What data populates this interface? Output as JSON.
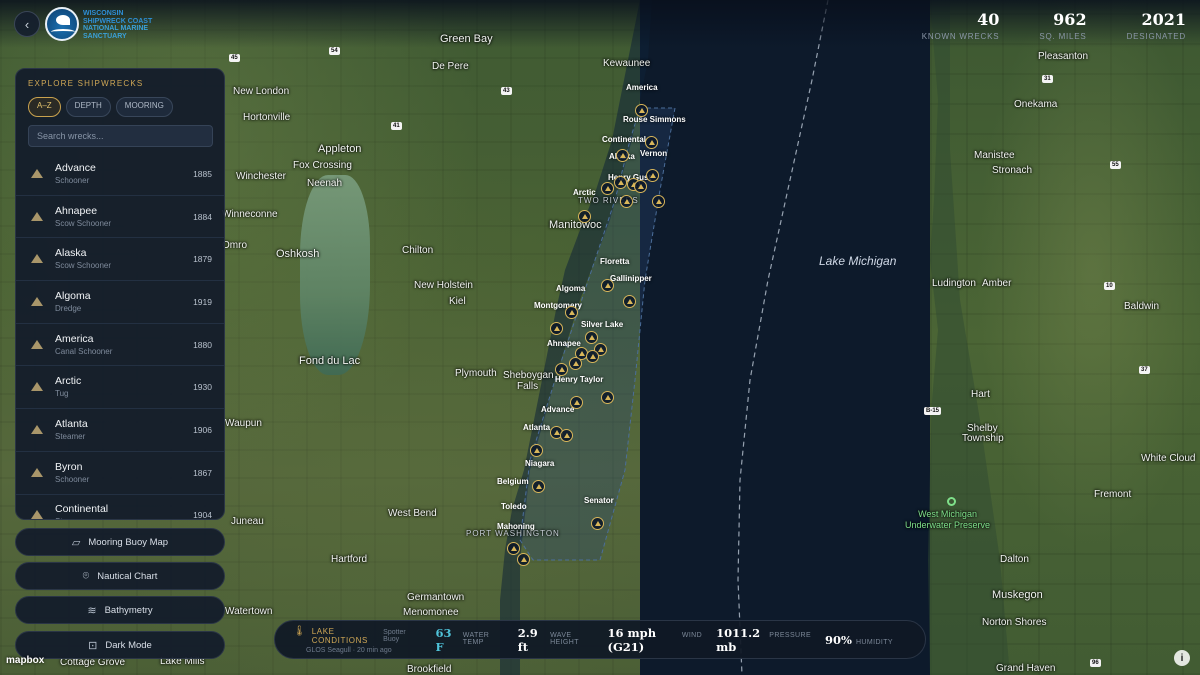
{
  "header": {
    "logo_lines": [
      "WISCONSIN",
      "SHIPWRECK COAST",
      "NATIONAL MARINE",
      "SANCTUARY"
    ],
    "stats": [
      {
        "value": "40",
        "label": "KNOWN WRECKS"
      },
      {
        "value": "962",
        "label": "SQ. MILES"
      },
      {
        "value": "2021",
        "label": "DESIGNATED"
      }
    ]
  },
  "sidebar": {
    "title": "EXPLORE SHIPWRECKS",
    "tabs": [
      "A–Z",
      "DEPTH",
      "MOORING"
    ],
    "active_tab": "A–Z",
    "search_placeholder": "Search wrecks...",
    "wrecks": [
      {
        "name": "Advance",
        "type": "Schooner",
        "year": "1885"
      },
      {
        "name": "Ahnapee",
        "type": "Scow Schooner",
        "year": "1884"
      },
      {
        "name": "Alaska",
        "type": "Scow Schooner",
        "year": "1879"
      },
      {
        "name": "Algoma",
        "type": "Dredge",
        "year": "1919"
      },
      {
        "name": "America",
        "type": "Canal Schooner",
        "year": "1880"
      },
      {
        "name": "Arctic",
        "type": "Tug",
        "year": "1930"
      },
      {
        "name": "Atlanta",
        "type": "Steamer",
        "year": "1906"
      },
      {
        "name": "Byron",
        "type": "Schooner",
        "year": "1867"
      },
      {
        "name": "Continental",
        "type": "Steamer",
        "year": "1904"
      }
    ]
  },
  "layers": [
    {
      "label": "Mooring Buoy Map",
      "icon": "map-icon"
    },
    {
      "label": "Nautical Chart",
      "icon": "pin-icon"
    },
    {
      "label": "Bathymetry",
      "icon": "waves-icon"
    },
    {
      "label": "Dark Mode",
      "icon": "target-icon"
    }
  ],
  "conditions": {
    "title": "LAKE CONDITIONS",
    "source": "Spotter Buoy",
    "subtitle": "GLOS Seagull · 20 min ago",
    "metrics": [
      {
        "value": "63 F",
        "unit": "WATER TEMP"
      },
      {
        "value": "2.9 ft",
        "unit": "WAVE HEIGHT"
      },
      {
        "value": "16 mph (G21)",
        "unit": "WIND"
      },
      {
        "value": "1011.2 mb",
        "unit": "PRESSURE"
      },
      {
        "value": "90%",
        "unit": "HUMIDITY"
      }
    ]
  },
  "map": {
    "water_label": "Lake Michigan",
    "preserve_label_1": "West Michigan",
    "preserve_label_2": "Underwater Preserve",
    "mapbox_label": "mapbox",
    "places": [
      "Green Bay",
      "De Pere",
      "Kewaunee",
      "Appleton",
      "Neenah",
      "Fox Crossing",
      "Hortonville",
      "New London",
      "Winchester",
      "Winneconne",
      "Omro",
      "Oshkosh",
      "Chilton",
      "Manitowoc",
      "TWO RIVERS",
      "New Holstein",
      "Kiel",
      "Fond du Lac",
      "Plymouth",
      "Sheboygan",
      "Falls",
      "West Bend",
      "Hartford",
      "Juneau",
      "Waupun",
      "Germantown",
      "Menomonee",
      "Watertown",
      "Lake Mills",
      "Cottage Grove",
      "Brookfield",
      "PORT WASHINGTON",
      "Pleasanton",
      "Onekama",
      "Manistee",
      "Stronach",
      "Ludington",
      "Amber",
      "Baldwin",
      "Hart",
      "Shelby",
      "Township",
      "White Cloud",
      "Fremont",
      "Dalton",
      "Muskegon",
      "Norton Shores",
      "Grand Haven"
    ],
    "wrecks_on_map": [
      "America",
      "Rouse Simmons",
      "Continental",
      "Vernon",
      "Alaska",
      "Henry Gust",
      "Arctic",
      "Floretta",
      "Gallinipper",
      "Algoma",
      "Montgomery",
      "Silver Lake",
      "Ahnapee",
      "Henry Taylor",
      "Advance",
      "Atlanta",
      "Niagara",
      "Belgium",
      "Toledo",
      "Senator",
      "Mahoning"
    ],
    "routes": [
      "54",
      "45",
      "41",
      "43",
      "55",
      "31",
      "10",
      "37",
      "B-15",
      "96"
    ]
  }
}
